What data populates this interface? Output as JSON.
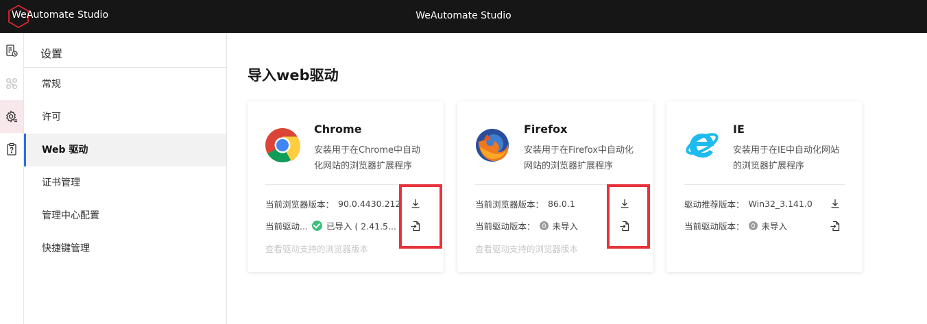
{
  "app": {
    "brand": "WeAutomate Studio",
    "window_title": "WeAutomate Studio",
    "accent_color": "#2b6de0",
    "highlight_color": "#e8323b"
  },
  "rail": {
    "items": [
      {
        "icon": "document-clock-icon"
      },
      {
        "icon": "workflow-nodes-icon"
      },
      {
        "icon": "settings-gear-icon",
        "active": true
      },
      {
        "icon": "clipboard-help-icon"
      }
    ]
  },
  "sidebar": {
    "title": "设置",
    "items": [
      {
        "label": "常规"
      },
      {
        "label": "许可"
      },
      {
        "label": "Web 驱动",
        "active": true
      },
      {
        "label": "证书管理"
      },
      {
        "label": "管理中心配置"
      },
      {
        "label": "快捷键管理"
      }
    ]
  },
  "main": {
    "heading": "导入web驱动",
    "cards": [
      {
        "name": "Chrome",
        "description": "安装用于在Chrome中自动化网站的浏览器扩展程序",
        "logo_icon": "chrome-logo-icon",
        "row1_label": "当前浏览器版本：",
        "row1_value": "90.0.4430.212",
        "row2_label": "当前驱动...",
        "row2_status": "已导入 ( 2.41.5...",
        "row2_status_icon": "check-circle-icon",
        "link": "查看驱动支持的浏览器版本"
      },
      {
        "name": "Firefox",
        "description": "安装用于在Firefox中自动化网站的浏览器扩展程序",
        "logo_icon": "firefox-logo-icon",
        "row1_label": "当前浏览器版本：",
        "row1_value": "86.0.1",
        "row2_label": "当前驱动版本：",
        "row2_status": "未导入",
        "row2_status_icon": "not-imported-icon",
        "link": "查看驱动支持的浏览器版本"
      },
      {
        "name": "IE",
        "description": "安装用于在IE中自动化网站的浏览器扩展程序",
        "logo_icon": "ie-logo-icon",
        "row1_label": "驱动推荐版本：",
        "row1_value": "Win32_3.141.0",
        "row2_label": "当前驱动版本：",
        "row2_status": "未导入",
        "row2_status_icon": "not-imported-icon"
      }
    ]
  }
}
